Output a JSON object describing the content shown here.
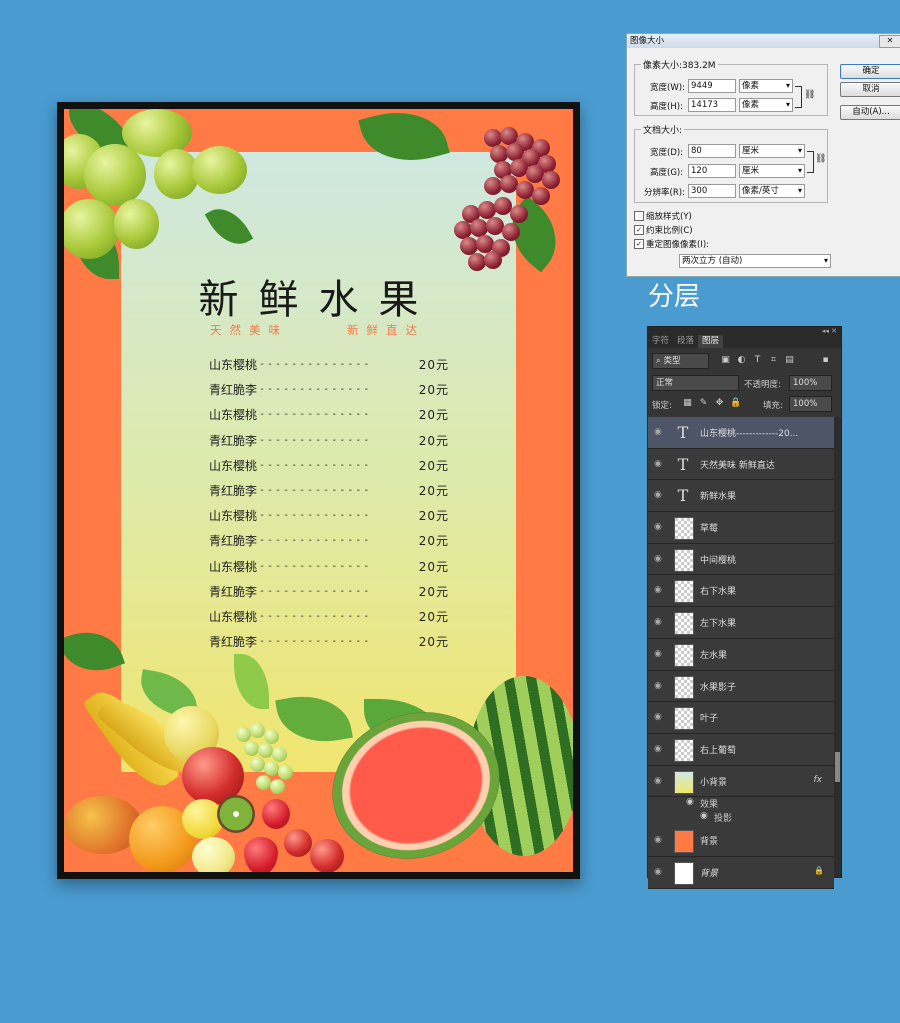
{
  "poster": {
    "title": "新鲜水果",
    "subtitle_left": "天然美味",
    "subtitle_right": "新鲜直达",
    "menu": [
      {
        "name": "山东樱桃",
        "price": "20元"
      },
      {
        "name": "青红脆李",
        "price": "20元"
      },
      {
        "name": "山东樱桃",
        "price": "20元"
      },
      {
        "name": "青红脆李",
        "price": "20元"
      },
      {
        "name": "山东樱桃",
        "price": "20元"
      },
      {
        "name": "青红脆李",
        "price": "20元"
      },
      {
        "name": "山东樱桃",
        "price": "20元"
      },
      {
        "name": "青红脆李",
        "price": "20元"
      },
      {
        "name": "山东樱桃",
        "price": "20元"
      },
      {
        "name": "青红脆李",
        "price": "20元"
      },
      {
        "name": "山东樱桃",
        "price": "20元"
      },
      {
        "name": "青红脆李",
        "price": "20元"
      }
    ],
    "dots": "--------------",
    "colors": {
      "frame": "#ff7a45",
      "accent": "#f07a4a"
    }
  },
  "dialog": {
    "title": "图像大小",
    "close": "✕",
    "pixel_group": "像素大小:383.2M",
    "width_label": "宽度(W):",
    "width_value": "9449",
    "width_unit": "像素",
    "height_label": "高度(H):",
    "height_value": "14173",
    "height_unit": "像素",
    "doc_group": "文档大小:",
    "doc_width_label": "宽度(D):",
    "doc_width_value": "80",
    "doc_width_unit": "厘米",
    "doc_height_label": "高度(G):",
    "doc_height_value": "120",
    "doc_height_unit": "厘米",
    "resolution_label": "分辨率(R):",
    "resolution_value": "300",
    "resolution_unit": "像素/英寸",
    "scale_styles": "缩放样式(Y)",
    "constrain": "约束比例(C)",
    "resample": "重定图像像素(I):",
    "resample_method": "两次立方 (自动)",
    "ok": "确定",
    "cancel": "取消",
    "auto": "自动(A)..."
  },
  "caption": "分层",
  "layers_panel": {
    "collapse": "◂◂ ✕",
    "tabs": [
      "字符",
      "段落",
      "图层"
    ],
    "filter": "类型",
    "blend_mode": "正常",
    "opacity_label": "不透明度:",
    "opacity_value": "100%",
    "lock_label": "锁定:",
    "fill_label": "填充:",
    "fill_value": "100%",
    "layers": [
      {
        "name": "山东樱桃-------------20...",
        "kind": "text"
      },
      {
        "name": "天然美味  新鲜直达",
        "kind": "text"
      },
      {
        "name": "新鲜水果",
        "kind": "text"
      },
      {
        "name": "草莓",
        "kind": "image"
      },
      {
        "name": "中间樱桃",
        "kind": "image"
      },
      {
        "name": "右下水果",
        "kind": "image"
      },
      {
        "name": "左下水果",
        "kind": "image"
      },
      {
        "name": "左水果",
        "kind": "image"
      },
      {
        "name": "水果影子",
        "kind": "image"
      },
      {
        "name": "叶子",
        "kind": "image"
      },
      {
        "name": "右上葡萄",
        "kind": "image"
      },
      {
        "name": "小背景",
        "kind": "image"
      },
      {
        "name": "背景",
        "kind": "image"
      },
      {
        "name": "背景",
        "kind": "locked"
      }
    ],
    "effects_label": "效果",
    "shadow_label": "投影",
    "fx": "fx"
  }
}
